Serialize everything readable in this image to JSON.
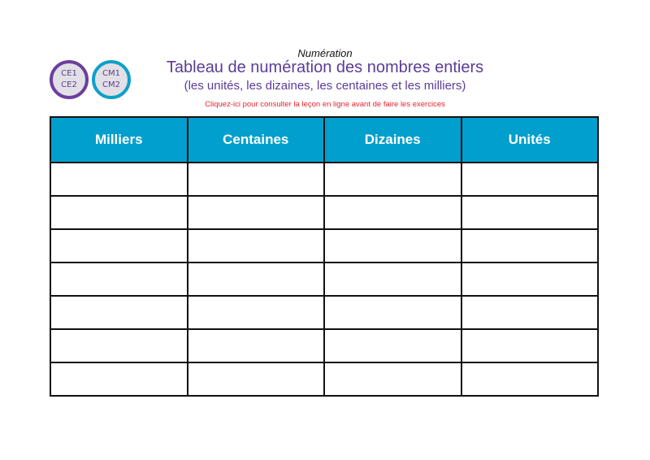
{
  "badges": [
    {
      "lines": [
        "CE1",
        "CE2"
      ],
      "color": "#6a3f9e"
    },
    {
      "lines": [
        "CM1",
        "CM2"
      ],
      "color": "#0fa0c8"
    }
  ],
  "header": {
    "subject": "Numération",
    "title": "Tableau de numération des nombres entiers",
    "subtitle": "(les unités, les dizaines, les centaines et les milliers)",
    "lesson_link": "Cliquez-ici pour consulter la leçon en ligne avant de faire les exercices"
  },
  "table": {
    "columns": [
      "Milliers",
      "Centaines",
      "Dizaines",
      "Unités"
    ],
    "row_count": 7,
    "header_color": "#009fcd"
  }
}
